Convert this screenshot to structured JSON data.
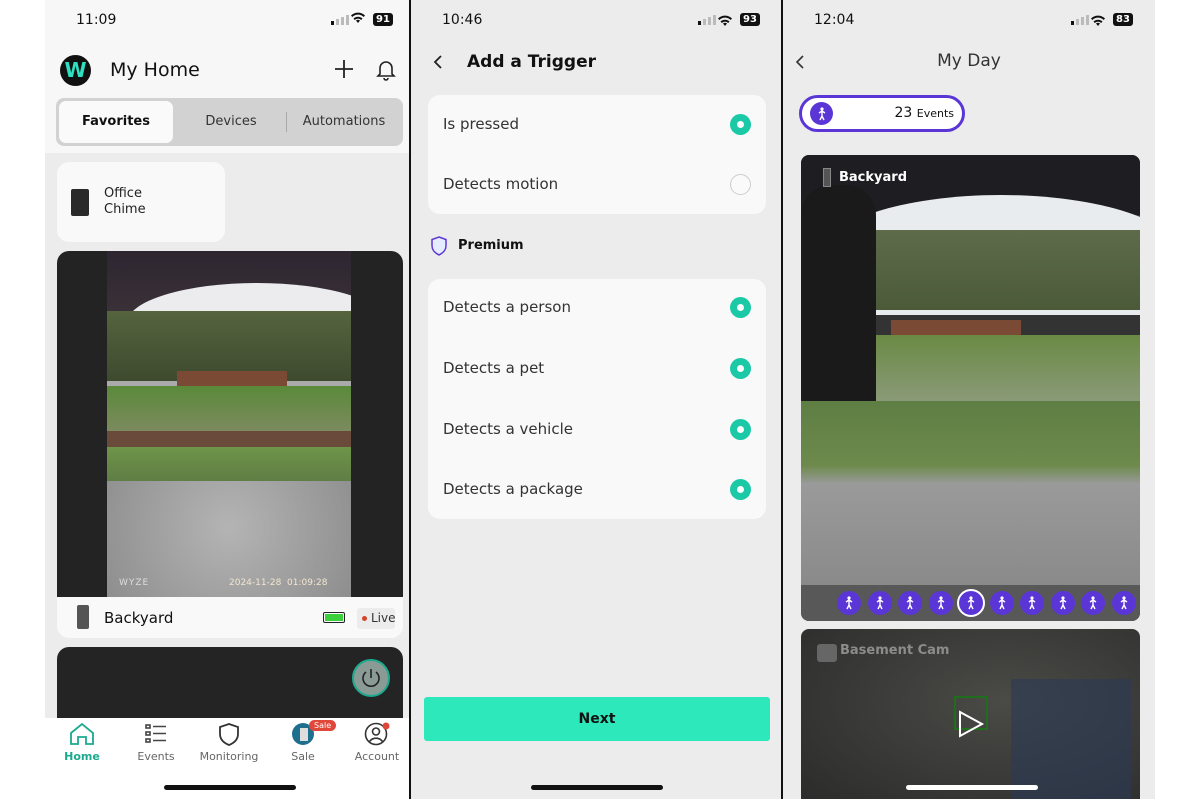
{
  "screen1": {
    "status": {
      "time": "11:09",
      "battery": "91"
    },
    "header": {
      "title": "My Home",
      "logo_letter": "W"
    },
    "tabs": [
      {
        "label": "Favorites",
        "active": true
      },
      {
        "label": "Devices"
      },
      {
        "label": "Automations"
      }
    ],
    "device_tile": {
      "name_line1": "Office",
      "name_line2": "Chime"
    },
    "camera_card": {
      "name": "Backyard",
      "live_label": "Live",
      "watermark": "WYZE",
      "timestamp": "2024-11-28  01:09:28"
    },
    "bottom_nav": [
      {
        "label": "Home",
        "icon": "home-icon",
        "active": true
      },
      {
        "label": "Events",
        "icon": "list-icon"
      },
      {
        "label": "Monitoring",
        "icon": "shield-icon"
      },
      {
        "label": "Sale",
        "icon": "sale-icon",
        "badge": "Sale"
      },
      {
        "label": "Account",
        "icon": "account-icon"
      }
    ],
    "accent": "#1aaa8e"
  },
  "screen2": {
    "status": {
      "time": "10:46",
      "battery": "93"
    },
    "header": {
      "title": "Add a Trigger"
    },
    "basic_options": [
      {
        "label": "Is pressed",
        "selected": true
      },
      {
        "label": "Detects motion",
        "selected": false
      }
    ],
    "premium_label": "Premium",
    "premium_options": [
      {
        "label": "Detects a person",
        "selected": true
      },
      {
        "label": "Detects a pet",
        "selected": true
      },
      {
        "label": "Detects a vehicle",
        "selected": true
      },
      {
        "label": "Detects a package",
        "selected": true
      }
    ],
    "next_label": "Next",
    "accent": "#2de8bb"
  },
  "screen3": {
    "status": {
      "time": "12:04",
      "battery": "83"
    },
    "header": {
      "title": "My Day"
    },
    "events_pill": {
      "count": "23",
      "label": "Events"
    },
    "cameras": [
      {
        "name": "Backyard"
      },
      {
        "name": "Basement Cam"
      }
    ],
    "event_icons_count": 10,
    "selected_event_index": 4,
    "accent": "#5b36d6"
  }
}
